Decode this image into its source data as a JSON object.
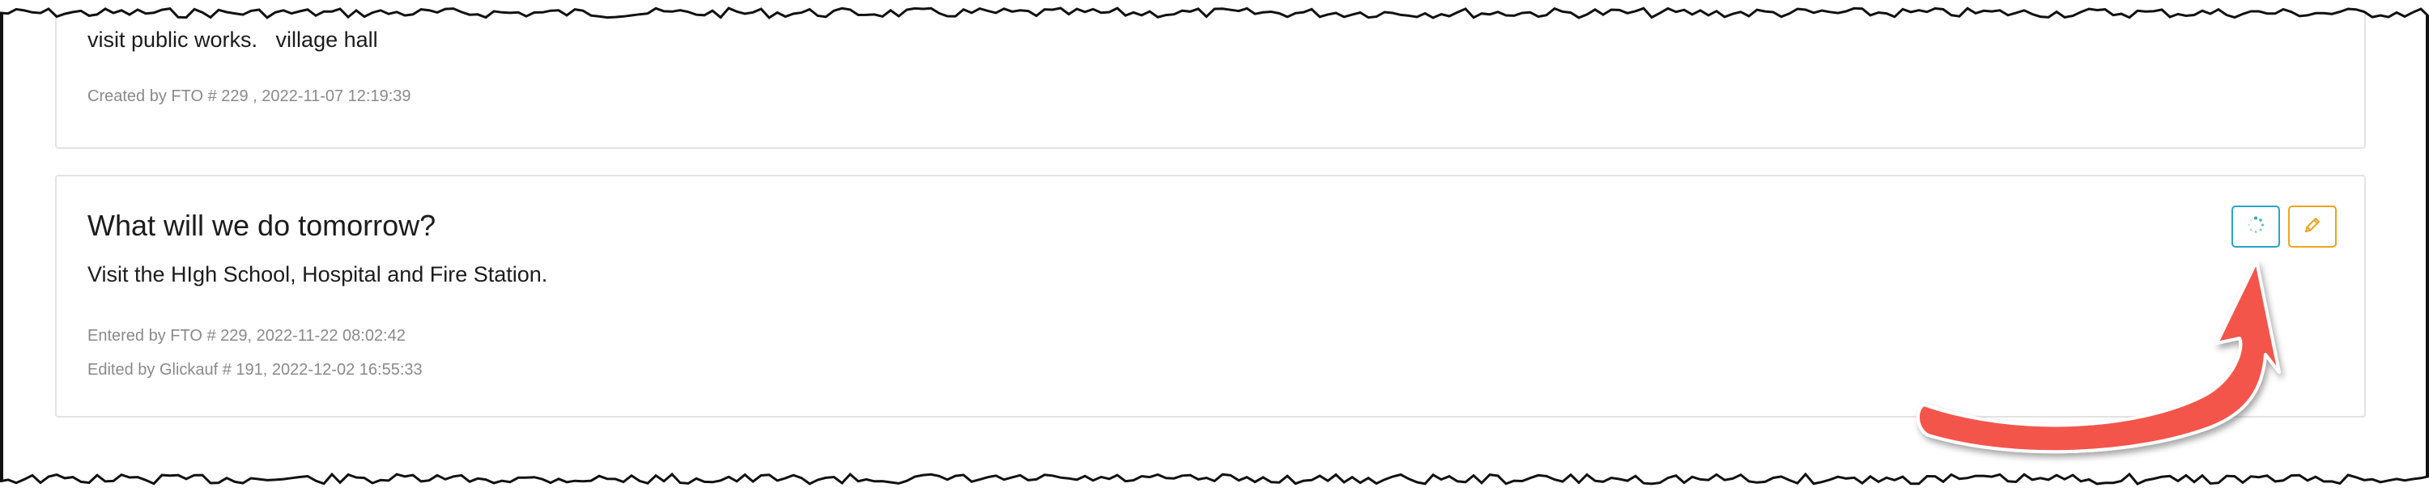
{
  "note_1": {
    "body": "visit public works.   village hall",
    "created": "Created by FTO # 229 , 2022-11-07 12:19:39"
  },
  "note_2": {
    "title": "What will we do tomorrow?",
    "body": "Visit the HIgh School, Hospital and Fire Station.",
    "entered": "Entered by FTO # 229, 2022-11-22 08:02:42",
    "edited": "Edited by Glickauf # 191, 2022-12-02 16:55:33",
    "actions": [
      {
        "name": "loading",
        "icon": "spinner-icon",
        "color": "#2aa3cf"
      },
      {
        "name": "edit",
        "icon": "pencil-icon",
        "color": "#f0a31c"
      }
    ]
  },
  "annotation": {
    "arrow_color": "#f4554b"
  }
}
